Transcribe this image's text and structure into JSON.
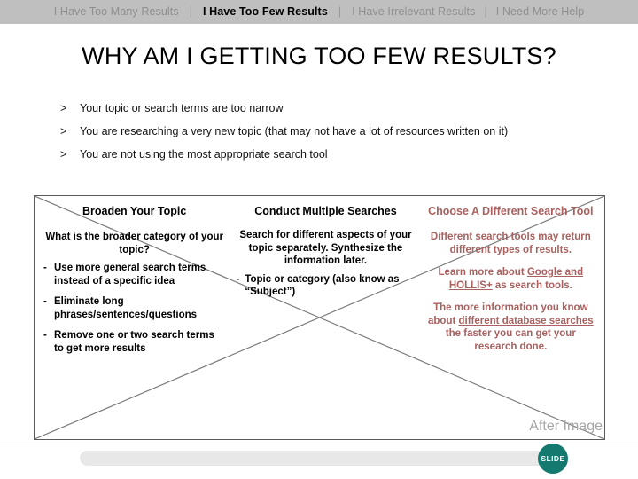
{
  "nav": {
    "items": [
      {
        "label": "I Have Too Many Results",
        "active": false
      },
      {
        "label": "I Have Too Few Results",
        "active": true
      },
      {
        "label": "I Have Irrelevant Results",
        "active": false
      },
      {
        "label": "I Need More Help",
        "active": false
      }
    ],
    "separator": "|"
  },
  "title": "WHY AM I GETTING TOO FEW RESULTS?",
  "reasons": {
    "marker": ">",
    "items": [
      "Your topic or search terms are too narrow",
      "You are researching a very new topic (that may not have a lot of resources written on it)",
      "You are not using the most appropriate search tool"
    ]
  },
  "columns": [
    {
      "heading": "Broaden Your Topic",
      "intro": "What is the broader category of your topic?",
      "marker": "-",
      "bullets": [
        "Use more general search terms instead of a specific idea",
        "Eliminate long phrases/sentences/questions",
        "Remove one or two search terms to get more results"
      ]
    },
    {
      "heading": "Conduct Multiple Searches",
      "intro": "Search for different aspects of your topic separately. Synthesize the information later.",
      "marker": "-",
      "bullets": [
        "Topic or category (also know as “Subject”)"
      ]
    },
    {
      "heading": "Choose A Different Search Tool",
      "paragraphs": [
        {
          "parts": [
            {
              "text": "Different search tools may return different types of results.",
              "link": false
            }
          ]
        },
        {
          "parts": [
            {
              "text": "Learn more about ",
              "link": false
            },
            {
              "text": "Google and HOLLIS+",
              "link": true
            },
            {
              "text": " as search tools.",
              "link": false
            }
          ]
        },
        {
          "parts": [
            {
              "text": "The more information you know about ",
              "link": false
            },
            {
              "text": "different database searches",
              "link": true
            },
            {
              "text": " the faster you can get your research done.",
              "link": false
            }
          ]
        }
      ]
    }
  ],
  "after_image_label": "After Image",
  "slide_badge": "SLIDE",
  "colors": {
    "navbar_bg": "#bfbfbf",
    "nav_inactive": "#8f8f8f",
    "nav_active": "#000000",
    "column_three_text": "#a8615f",
    "slide_badge_bg": "#147a70",
    "after_image_text": "#a6a6a6",
    "progress_track": "#e8e8e8",
    "box_border": "#5a5a5a"
  }
}
